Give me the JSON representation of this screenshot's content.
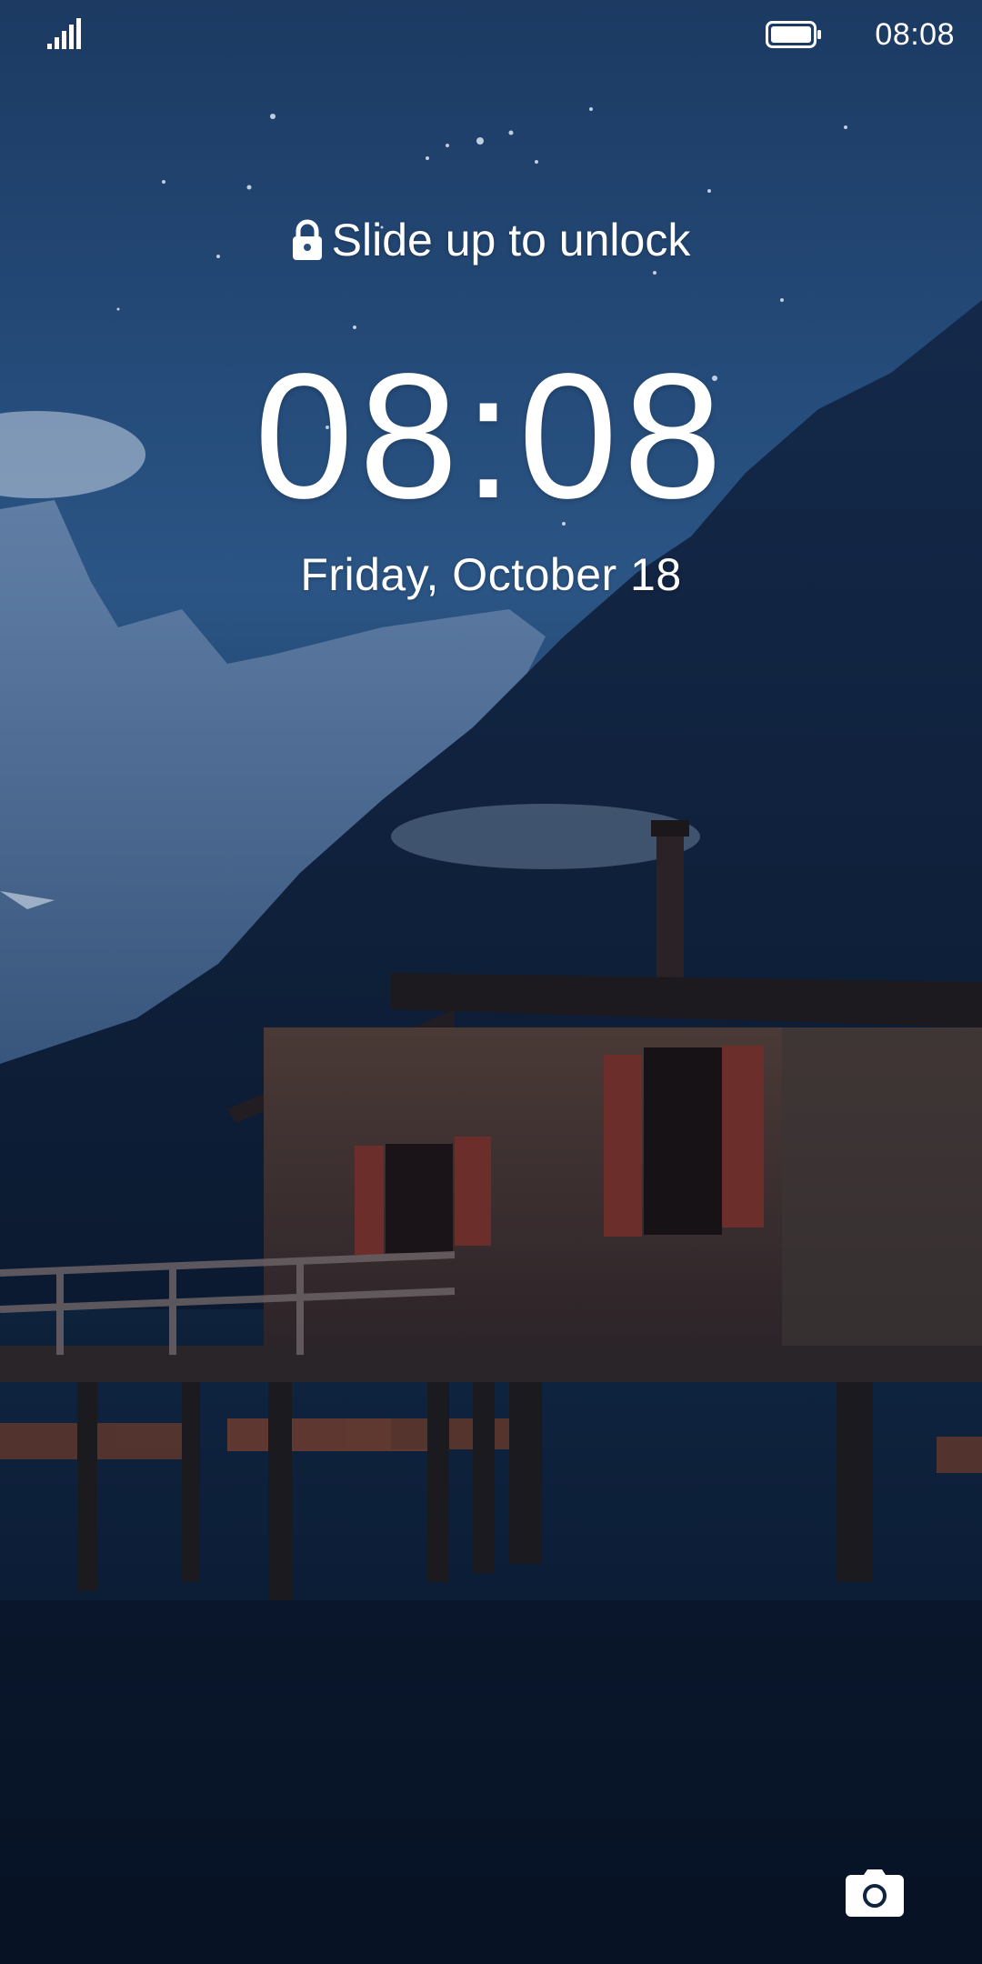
{
  "status_bar": {
    "time": "08:08",
    "signal_icon": "signal-icon",
    "battery_icon": "battery-icon"
  },
  "lock_screen": {
    "unlock_hint": "Slide up to unlock",
    "lock_icon": "lock-icon",
    "clock": "08:08",
    "date": "Friday, October 18",
    "camera_icon": "camera-icon"
  },
  "colors": {
    "sky_top": "#1c3a62",
    "sky_mid": "#2b5585",
    "water": "#0a1830",
    "text": "#ffffff"
  }
}
